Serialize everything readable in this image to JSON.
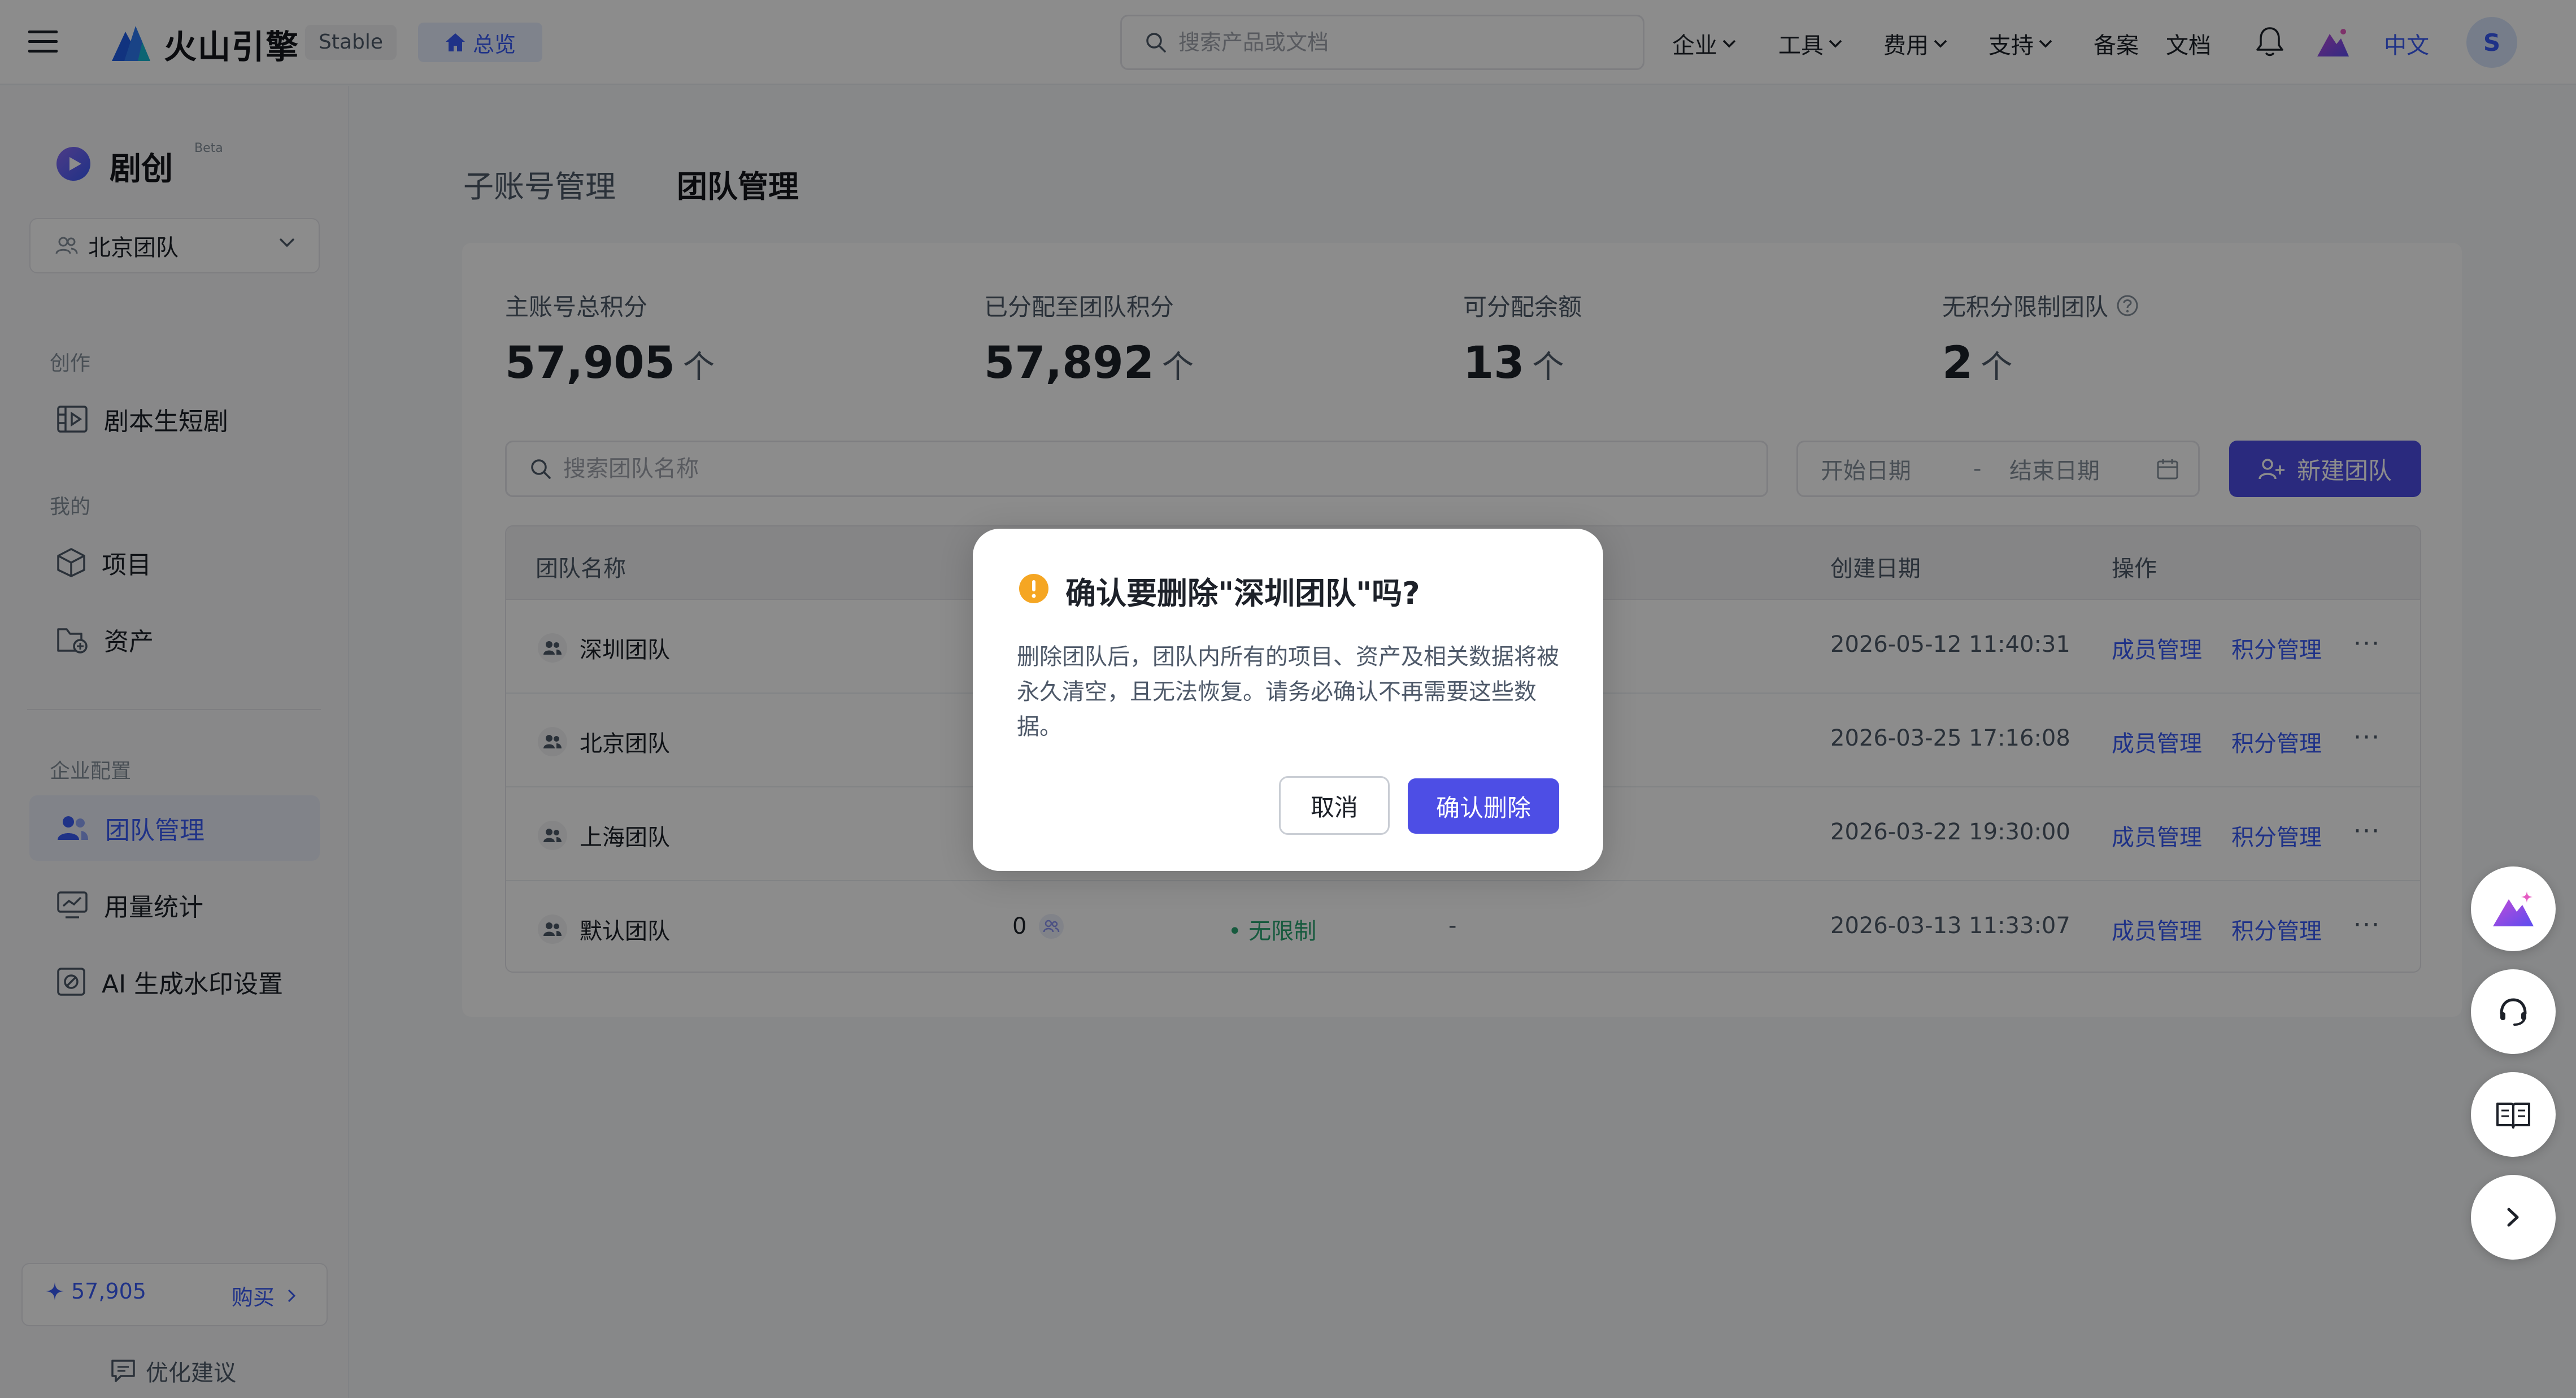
{
  "topbar": {
    "brand": "火山引擎",
    "env_badge": "Stable",
    "overview": "总览",
    "search_placeholder": "搜索产品或文档",
    "nav": [
      {
        "label": "企业"
      },
      {
        "label": "工具"
      },
      {
        "label": "费用"
      },
      {
        "label": "支持"
      },
      {
        "label": "备案"
      },
      {
        "label": "文档"
      }
    ],
    "language": "中文",
    "avatar": "S"
  },
  "sidebar": {
    "app_title": "剧创",
    "beta": "Beta",
    "team_select": "北京团队",
    "groups": {
      "create": "创作",
      "mine": "我的",
      "enterprise": "企业配置"
    },
    "items": [
      {
        "label": "剧本生短剧"
      },
      {
        "label": "项目"
      },
      {
        "label": "资产"
      },
      {
        "label": "团队管理"
      },
      {
        "label": "用量统计"
      },
      {
        "label": "AI 生成水印设置"
      }
    ],
    "credits": "57,905",
    "buy": "购买",
    "feedback": "优化建议"
  },
  "main": {
    "tabs": [
      "子账号管理",
      "团队管理"
    ],
    "stats": [
      {
        "label": "主账号总积分",
        "value": "57,905",
        "unit": "个"
      },
      {
        "label": "已分配至团队积分",
        "value": "57,892",
        "unit": "个"
      },
      {
        "label": "可分配余额",
        "value": "13",
        "unit": "个"
      },
      {
        "label": "无积分限制团队",
        "value": "2",
        "unit": "个"
      }
    ],
    "team_search_placeholder": "搜索团队名称",
    "date_start": "开始日期",
    "date_sep": "-",
    "date_end": "结束日期",
    "new_team": "新建团队",
    "table": {
      "headers": {
        "name": "团队名称",
        "created": "创建日期",
        "actions": "操作"
      },
      "rows": [
        {
          "name": "深圳团队",
          "members": "",
          "credits": "",
          "extra": "",
          "created": "2026-05-12 11:40:31"
        },
        {
          "name": "北京团队",
          "members": "",
          "credits": "",
          "extra": "",
          "created": "2026-03-25 17:16:08"
        },
        {
          "name": "上海团队",
          "members": "",
          "credits": "",
          "extra": "",
          "created": "2026-03-22 19:30:00"
        },
        {
          "name": "默认团队",
          "members": "0",
          "credits": "• 无限制",
          "extra": "-",
          "created": "2026-03-13 11:33:07"
        }
      ],
      "action_members": "成员管理",
      "action_credits": "积分管理",
      "action_more": "···"
    }
  },
  "dialog": {
    "title": "确认要删除\"深圳团队\"吗?",
    "body": "删除团队后，团队内所有的项目、资产及相关数据将被永久清空，且无法恢复。请务必确认不再需要这些数据。",
    "cancel": "取消",
    "confirm": "确认删除"
  },
  "colors": {
    "accent": "#4d4ee5",
    "link": "#3a5bf6",
    "success": "#2ba471",
    "warning": "#f5a623"
  }
}
